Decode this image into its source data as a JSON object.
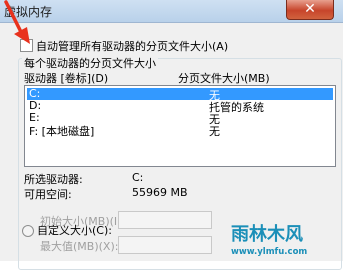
{
  "window": {
    "title": "虚拟内存",
    "close_glyph": "✕"
  },
  "auto_manage": {
    "label": "自动管理所有驱动器的分页文件大小(A)",
    "checked": false
  },
  "group": {
    "legend": "每个驱动器的分页文件大小",
    "col_drive": "驱动器 [卷标](D)",
    "col_size": "分页文件大小(MB)"
  },
  "drives": [
    {
      "drive": "C:",
      "size": "无",
      "selected": true
    },
    {
      "drive": "D:",
      "size": "托管的系统",
      "selected": false
    },
    {
      "drive": "E:",
      "size": "无",
      "selected": false
    },
    {
      "drive": "F:   [本地磁盘]",
      "size": "无",
      "selected": false
    }
  ],
  "info": {
    "selected_label": "所选驱动器:",
    "selected_value": "C:",
    "space_label": "可用空间:",
    "space_value": "55969 MB"
  },
  "custom": {
    "radio_label": "自定义大小(C):",
    "initial_label": "初始大小(MB)(I):",
    "max_label": "最大值(MB)(X):"
  },
  "watermark": {
    "brand": "雨林木风",
    "url": "www.ylmfu.com"
  },
  "colors": {
    "selection": "#3399ff",
    "arrow": "#e8321e",
    "watermark": "#1b8fb8"
  }
}
